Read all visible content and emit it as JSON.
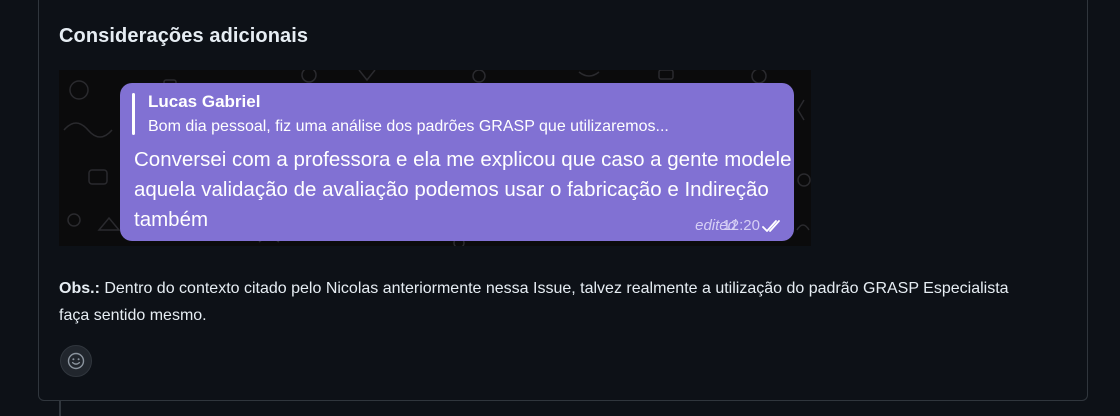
{
  "comment": {
    "heading": "Considerações adicionais",
    "image": {
      "reply_author": "Lucas Gabriel",
      "reply_snippet": "Bom dia pessoal, fiz uma análise dos padrões GRASP que utilizaremos...",
      "message": "Conversei com a professora e ela me explicou que caso a gente modele aquela validação de avaliação podemos usar o fabricação e Indireção também",
      "edited_label": "edited",
      "time": "12:20",
      "read_icon": "double-check-icon"
    },
    "obs_label": "Obs.:",
    "obs_text": " Dentro do contexto citado pelo Nicolas anteriormente nessa Issue, talvez realmente a utilização do padrão GRASP Especialista faça sentido mesmo.",
    "reaction_icon": "smiley-icon"
  },
  "colors": {
    "background": "#0d1117",
    "border": "#30363d",
    "text": "#e6edf3",
    "bubble": "#8171d3"
  }
}
